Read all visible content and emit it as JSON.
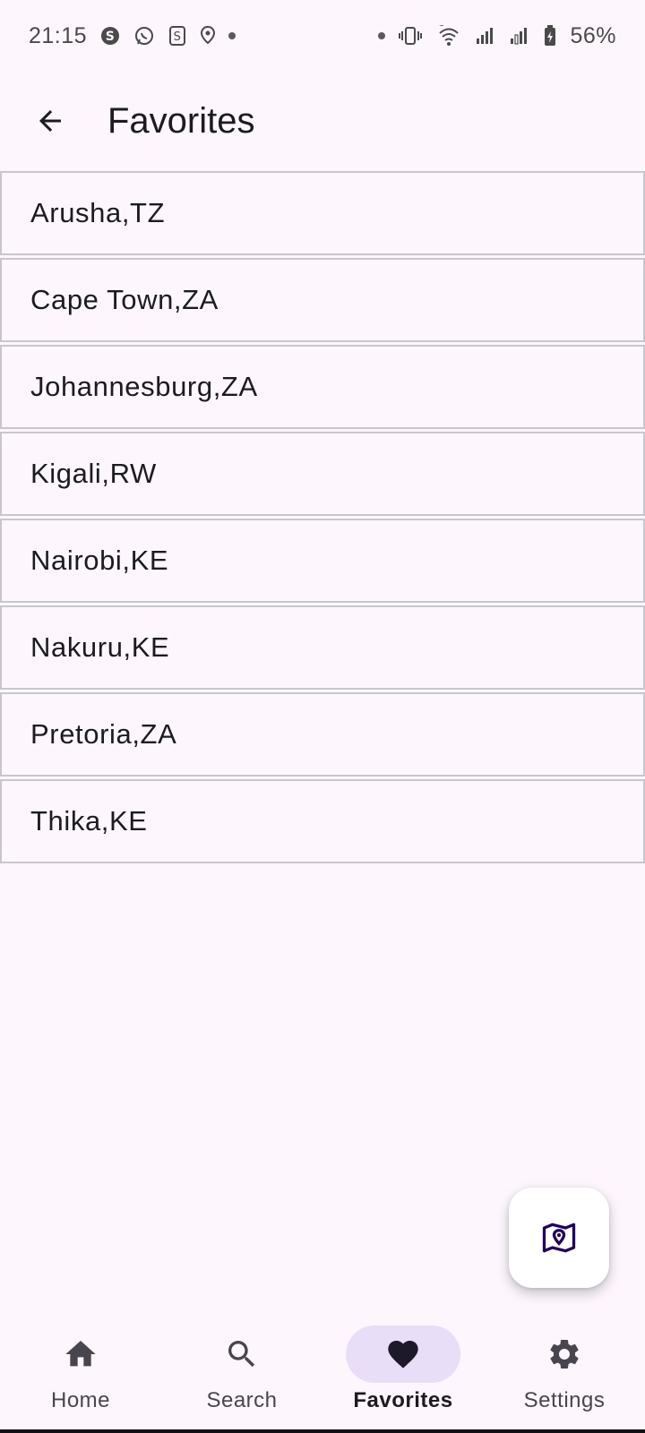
{
  "status_bar": {
    "time": "21:15",
    "battery": "56%",
    "left_icons": [
      "skype-icon",
      "whatsapp-icon",
      "s-app-icon",
      "location-pin-icon"
    ],
    "right_icons": [
      "vibrate-icon",
      "wifi-icon",
      "signal-icon",
      "signal-2-icon",
      "battery-icon"
    ]
  },
  "app_bar": {
    "title": "Favorites",
    "back_icon": "arrow-back-icon"
  },
  "favorites": [
    "Arusha,TZ",
    "Cape Town,ZA",
    "Johannesburg,ZA",
    "Kigali,RW",
    "Nairobi,KE",
    "Nakuru,KE",
    "Pretoria,ZA",
    "Thika,KE"
  ],
  "fab": {
    "icon": "map-pin-icon"
  },
  "bottom_nav": {
    "items": [
      {
        "label": "Home",
        "icon": "home-icon",
        "active": false
      },
      {
        "label": "Search",
        "icon": "search-icon",
        "active": false
      },
      {
        "label": "Favorites",
        "icon": "heart-icon",
        "active": true
      },
      {
        "label": "Settings",
        "icon": "gear-icon",
        "active": false
      }
    ]
  },
  "colors": {
    "background": "#fdf7fd",
    "active_indicator": "#e8def8",
    "fab_icon": "#21005d",
    "text": "#1c1b1f"
  }
}
